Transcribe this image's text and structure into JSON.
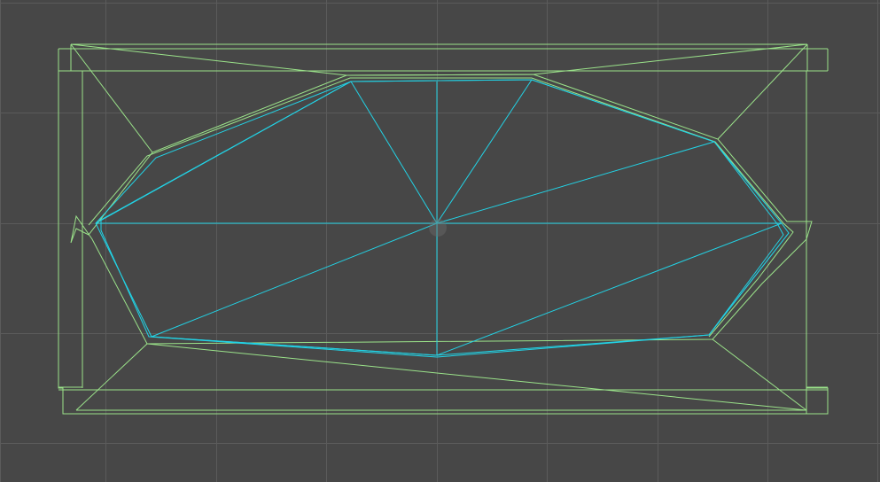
{
  "viewport": {
    "background": "#474747",
    "grid_color": "#5b5b5b",
    "grid_visible": true
  },
  "wireframe": {
    "physics_shape_color": "#9be38a",
    "render_mesh_color": "#22d3e6",
    "pivot_color": "#6a6a6a"
  }
}
